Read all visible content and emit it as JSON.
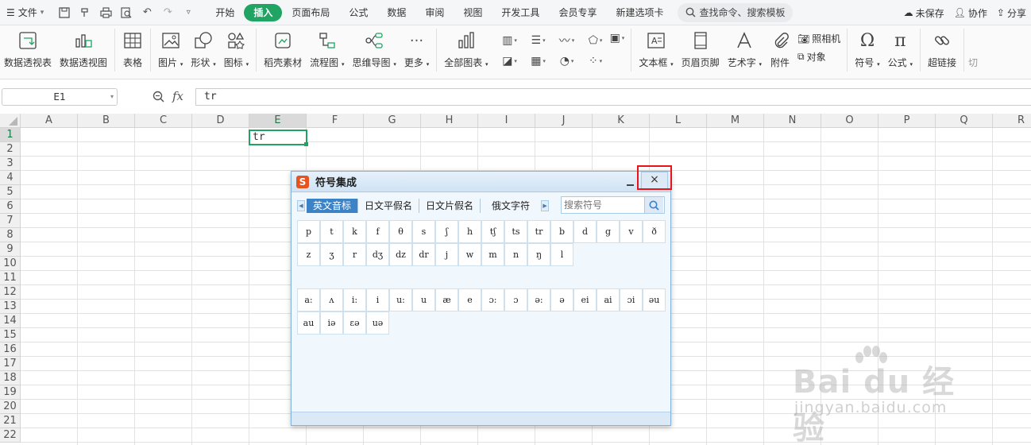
{
  "menubar": {
    "file_label": "文件",
    "tabs": [
      {
        "label": "开始",
        "active": false
      },
      {
        "label": "插入",
        "active": true
      },
      {
        "label": "页面布局",
        "active": false
      },
      {
        "label": "公式",
        "active": false
      },
      {
        "label": "数据",
        "active": false
      },
      {
        "label": "审阅",
        "active": false
      },
      {
        "label": "视图",
        "active": false
      },
      {
        "label": "开发工具",
        "active": false
      },
      {
        "label": "会员专享",
        "active": false
      },
      {
        "label": "新建选项卡",
        "active": false
      }
    ],
    "search_label": "查找命令、搜索模板",
    "unsaved": "未保存",
    "collab": "协作",
    "share": "分享",
    "accent_color": "#1fa463"
  },
  "ribbon": {
    "pivot_table": "数据透视表",
    "pivot_chart": "数据透视图",
    "table": "表格",
    "picture": "图片",
    "shapes": "形状",
    "icons": "图标",
    "materials": "稻壳素材",
    "flowchart": "流程图",
    "mindmap": "思维导图",
    "more": "更多",
    "all_charts": "全部图表",
    "textbox": "文本框",
    "header_footer": "页眉页脚",
    "wordart": "艺术字",
    "attachment": "附件",
    "camera": "照相机",
    "object": "对象",
    "symbol": "符号",
    "formula": "公式",
    "hyperlink": "超链接",
    "cut_partial": "切"
  },
  "formula_bar": {
    "cell_ref": "E1",
    "fx_label": "fx",
    "content": "tr"
  },
  "sheet": {
    "columns": [
      "A",
      "B",
      "C",
      "D",
      "E",
      "F",
      "G",
      "H",
      "I",
      "J",
      "K",
      "L",
      "M",
      "N",
      "O",
      "P",
      "Q",
      "R"
    ],
    "rows": [
      "1",
      "2",
      "3",
      "4",
      "5",
      "6",
      "7",
      "8",
      "9",
      "10",
      "11",
      "12",
      "13",
      "14",
      "15",
      "16",
      "17",
      "18",
      "19",
      "20",
      "21",
      "22"
    ],
    "selected_column": "E",
    "selected_row": "1",
    "active_cell_value": "tr"
  },
  "dialog": {
    "title": "符号集成",
    "logo_letter": "S",
    "min_label": "_",
    "close_label": "×",
    "tabs": [
      {
        "label": "英文音标",
        "active": true
      },
      {
        "label": "日文平假名",
        "active": false
      },
      {
        "label": "日文片假名",
        "active": false
      },
      {
        "label": "俄文字符",
        "active": false
      }
    ],
    "search_placeholder": "搜索符号",
    "consonants": [
      "p",
      "t",
      "k",
      "f",
      "θ",
      "s",
      "ʃ",
      "h",
      "tʃ",
      "ts",
      "tr",
      "b",
      "d",
      "g",
      "v",
      "ð",
      "z",
      "ʒ",
      "r",
      "dʒ",
      "dz",
      "dr",
      "j",
      "w",
      "m",
      "n",
      "ŋ",
      "l"
    ],
    "vowels": [
      "a:",
      "ʌ",
      "i:",
      "i",
      "u:",
      "u",
      "æ",
      "e",
      "ɔ:",
      "ɔ",
      "ə:",
      "ə",
      "ei",
      "ai",
      "ɔi",
      "əu",
      "au",
      "iə",
      "εə",
      "uə"
    ]
  },
  "watermark": {
    "brand": "Bai du 经验",
    "url": "jingyan.baidu.com"
  }
}
